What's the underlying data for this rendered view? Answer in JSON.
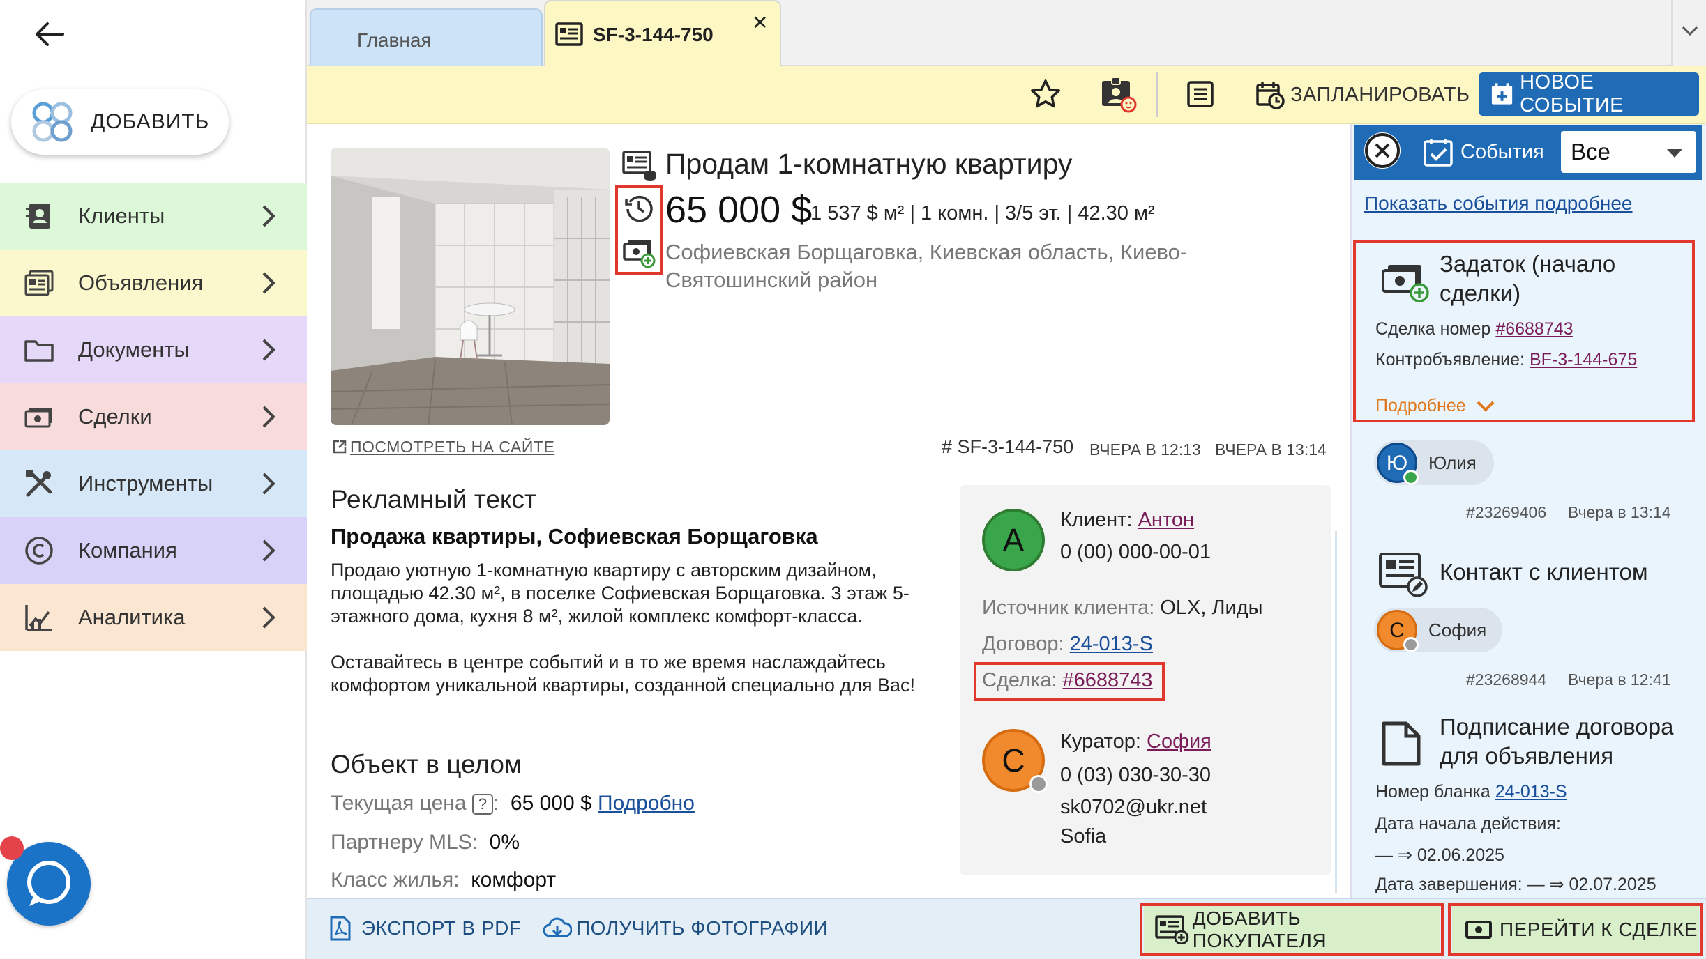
{
  "sidebar": {
    "add_label": "ДОБАВИТЬ",
    "items": [
      {
        "label": "Клиенты",
        "bg": "#dcf8d8"
      },
      {
        "label": "Объявления",
        "bg": "#faf8cc"
      },
      {
        "label": "Документы",
        "bg": "#e6d8f8"
      },
      {
        "label": "Сделки",
        "bg": "#f8dcdc"
      },
      {
        "label": "Инструменты",
        "bg": "#d6e8f8"
      },
      {
        "label": "Компания",
        "bg": "#d8d2f8"
      },
      {
        "label": "Аналитика",
        "bg": "#fbe6d2"
      }
    ]
  },
  "tabs": {
    "home": "Главная",
    "active": "SF-3-144-750",
    "close": "✕"
  },
  "toolbar": {
    "schedule": "ЗАПЛАНИРОВАТЬ",
    "new_event": "НОВОЕ СОБЫТИЕ"
  },
  "listing": {
    "title": "Продам 1-комнатную квартиру",
    "price": "65 000 $",
    "details": "1 537 $ м² | 1 комн. | 3/5 эт. | 42.30 м²",
    "address": "Софиевская Борщаговка, Киевская область, Киево-Святошинский район",
    "view_site": "ПОСМОТРЕТЬ НА САЙТЕ",
    "ref": "# SF-3-144-750",
    "created": "ВЧЕРА В 12:13",
    "updated": "ВЧЕРА В 13:14"
  },
  "ad": {
    "heading": "Рекламный текст",
    "subtitle": "Продажа квартиры, Софиевская Борщаговка",
    "para1": "Продаю уютную 1-комнатную квартиру с авторским дизайном, площадью 42.30 м², в поселке Софиевская Борщаговка. 3 этаж 5-этажного дома, кухня 8 м², жилой комплекс комфорт-класса.",
    "para2": "Оставайтесь в центре событий и в то же время наслаждайтесь комфортом уникальной квартиры, созданной специально для Вас!"
  },
  "object": {
    "heading": "Объект в целом",
    "price_label": "Текущая цена",
    "qmark": "?",
    "price_value": "65 000 $",
    "price_link": "Подробно",
    "mls_label": "Партнеру MLS:",
    "mls_value": "0%",
    "class_label": "Класс жилья:",
    "class_value": "комфорт"
  },
  "client": {
    "initial": "А",
    "label": "Клиент:",
    "name": "Антон",
    "phone": "0 (00) 000-00-01",
    "source_label": "Источник клиента:",
    "source_value": "OLX, Лиды",
    "contract_label": "Договор:",
    "contract_value": "24-013-S",
    "deal_label": "Сделка:",
    "deal_value": "#6688743",
    "curator_initial": "С",
    "curator_label": "Куратор:",
    "curator_name": "София",
    "curator_phone": "0 (03) 030-30-30",
    "curator_email": "sk0702@ukr.net",
    "curator_alias": "Sofia"
  },
  "events": {
    "label": "События",
    "filter": "Все",
    "show_more": "Показать события подробнее",
    "items": [
      {
        "title": "Задаток (начало сделки)",
        "line1_label": "Сделка номер",
        "line1_value": "#6688743",
        "line2_label": "Контробъявление:",
        "line2_value": "BF-3-144-675",
        "more": "Подробнее",
        "user_initial": "Ю",
        "user": "Юлия",
        "id": "#23269406",
        "time": "Вчера в 13:14"
      },
      {
        "title": "Контакт с клиентом",
        "user_initial": "С",
        "user": "София",
        "id": "#23268944",
        "time": "Вчера в 12:41"
      },
      {
        "title": "Подписание договора для объявления",
        "line1_label": "Номер бланка",
        "line1_value": "24-013-S",
        "line2_label": "Дата начала действия:",
        "line3": "— ⇒ 02.06.2025",
        "line4": "Дата завершения: — ⇒ 02.07.2025"
      }
    ]
  },
  "bottom": {
    "export_pdf": "ЭКСПОРТ В PDF",
    "get_photos": "ПОЛУЧИТЬ ФОТОГРАФИИ",
    "add_buyer": "ДОБАВИТЬ ПОКУПАТЕЛЯ",
    "go_deal": "ПЕРЕЙТИ К СДЕЛКЕ"
  },
  "colors": {
    "accent": "#1f6bb5",
    "highlight": "#e1372c",
    "link": "#7a1c5a",
    "green_btn": "#d8efc9",
    "yellow": "#fdf7c3"
  }
}
